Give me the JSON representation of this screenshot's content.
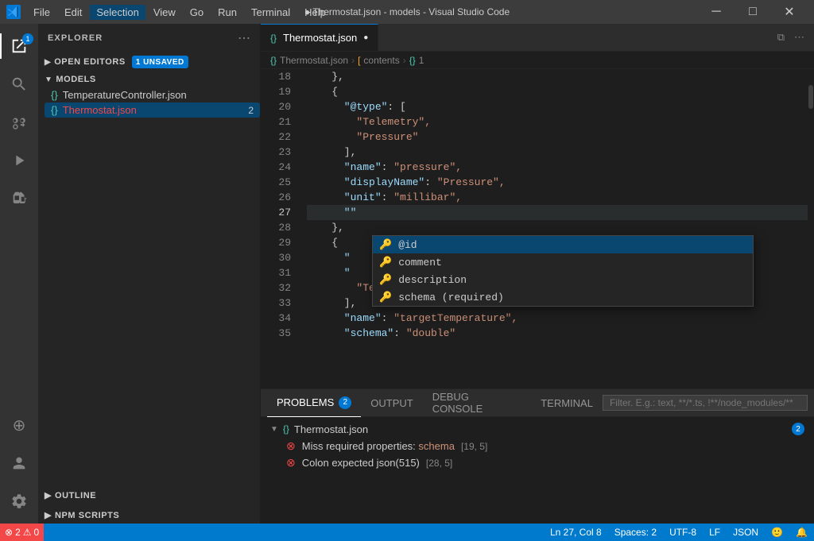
{
  "titlebar": {
    "logo": "VS",
    "menu_items": [
      "File",
      "Edit",
      "Selection",
      "View",
      "Go",
      "Run",
      "Terminal",
      "Help"
    ],
    "active_menu": "Selection",
    "title": "● Thermostat.json - models - Visual Studio Code",
    "ctrl_minimize": "─",
    "ctrl_maximize": "□",
    "ctrl_close": "✕"
  },
  "activity_bar": {
    "icons": [
      {
        "name": "explorer-icon",
        "symbol": "⎘",
        "active": true,
        "badge": "1"
      },
      {
        "name": "search-icon",
        "symbol": "🔍",
        "active": false
      },
      {
        "name": "source-control-icon",
        "symbol": "⑂",
        "active": false
      },
      {
        "name": "run-icon",
        "symbol": "▷",
        "active": false
      },
      {
        "name": "extensions-icon",
        "symbol": "⊞",
        "active": false
      },
      {
        "name": "remote-explorer-icon",
        "symbol": "⊕",
        "active": false
      }
    ],
    "bottom_icons": [
      {
        "name": "account-icon",
        "symbol": "👤"
      },
      {
        "name": "settings-icon",
        "symbol": "⚙"
      }
    ]
  },
  "sidebar": {
    "header": "EXPLORER",
    "sections": {
      "open_editors": {
        "label": "OPEN EDITORS",
        "badge": "1 UNSAVED",
        "collapsed": false
      },
      "models": {
        "label": "MODELS",
        "expanded": true,
        "files": [
          {
            "name": "TemperatureController.json",
            "icon": "{}",
            "active": false,
            "errors": 0
          },
          {
            "name": "Thermostat.json",
            "icon": "{}",
            "active": true,
            "errors": 2
          }
        ]
      },
      "outline": {
        "label": "OUTLINE"
      },
      "npm_scripts": {
        "label": "NPM SCRIPTS"
      }
    }
  },
  "editor": {
    "tab": {
      "icon": "{}",
      "filename": "Thermostat.json",
      "modified": true
    },
    "breadcrumb": [
      {
        "icon": "{}",
        "text": "Thermostat.json"
      },
      {
        "icon": "[",
        "text": "contents"
      },
      {
        "icon": "{}",
        "text": "1"
      }
    ],
    "lines": [
      {
        "num": 18,
        "content": "    },",
        "tokens": [
          {
            "t": "s-punct",
            "v": "    },"
          }
        ]
      },
      {
        "num": 19,
        "content": "    {",
        "tokens": [
          {
            "t": "s-punct",
            "v": "    {"
          }
        ]
      },
      {
        "num": 20,
        "content": "      \"@type\": [",
        "tokens": [
          {
            "t": "s-key",
            "v": "      \"@type\""
          },
          {
            "t": "s-punct",
            "v": ": ["
          }
        ]
      },
      {
        "num": 21,
        "content": "        \"Telemetry\",",
        "tokens": [
          {
            "t": "s-string",
            "v": "        \"Telemetry\","
          }
        ]
      },
      {
        "num": 22,
        "content": "        \"Pressure\"",
        "tokens": [
          {
            "t": "s-string",
            "v": "        \"Pressure\""
          }
        ]
      },
      {
        "num": 23,
        "content": "      ],",
        "tokens": [
          {
            "t": "s-punct",
            "v": "      ],"
          }
        ]
      },
      {
        "num": 24,
        "content": "      \"name\": \"pressure\",",
        "tokens": [
          {
            "t": "s-key",
            "v": "      \"name\""
          },
          {
            "t": "s-punct",
            "v": ": "
          },
          {
            "t": "s-string",
            "v": "\"pressure\","
          }
        ]
      },
      {
        "num": 25,
        "content": "      \"displayName\": \"Pressure\",",
        "tokens": [
          {
            "t": "s-key",
            "v": "      \"displayName\""
          },
          {
            "t": "s-punct",
            "v": ": "
          },
          {
            "t": "s-string",
            "v": "\"Pressure\","
          }
        ]
      },
      {
        "num": 26,
        "content": "      \"unit\": \"millibar\",",
        "tokens": [
          {
            "t": "s-key",
            "v": "      \"unit\""
          },
          {
            "t": "s-punct",
            "v": ": "
          },
          {
            "t": "s-string",
            "v": "\"millibar\","
          }
        ]
      },
      {
        "num": 27,
        "content": "      \"\"",
        "tokens": [
          {
            "t": "s-key",
            "v": "      \"\""
          }
        ],
        "current": true
      },
      {
        "num": 28,
        "content": "    },",
        "tokens": [
          {
            "t": "s-punct",
            "v": "    },"
          }
        ]
      },
      {
        "num": 29,
        "content": "    {",
        "tokens": [
          {
            "t": "s-punct",
            "v": "    {"
          }
        ]
      },
      {
        "num": 30,
        "content": "      \"",
        "tokens": [
          {
            "t": "s-key",
            "v": "      \""
          }
        ]
      },
      {
        "num": 31,
        "content": "      \"",
        "tokens": [
          {
            "t": "s-key",
            "v": "      \""
          }
        ]
      },
      {
        "num": 32,
        "content": "        \"Temperature\"",
        "tokens": [
          {
            "t": "s-string",
            "v": "        \"Temperature\""
          }
        ]
      },
      {
        "num": 33,
        "content": "      ],",
        "tokens": [
          {
            "t": "s-punct",
            "v": "      ],"
          }
        ]
      },
      {
        "num": 34,
        "content": "      \"name\": \"targetTemperature\",",
        "tokens": [
          {
            "t": "s-key",
            "v": "      \"name\""
          },
          {
            "t": "s-punct",
            "v": ": "
          },
          {
            "t": "s-string",
            "v": "\"targetTemperature\","
          }
        ]
      },
      {
        "num": 35,
        "content": "      \"schema\": \"double\"",
        "tokens": [
          {
            "t": "s-key",
            "v": "      \"schema\""
          },
          {
            "t": "s-punct",
            "v": ": "
          },
          {
            "t": "s-string",
            "v": "\"double\""
          }
        ]
      }
    ],
    "autocomplete": {
      "items": [
        {
          "icon": "🔑",
          "text": "@id",
          "selected": true
        },
        {
          "icon": "🔑",
          "text": "comment",
          "selected": false
        },
        {
          "icon": "🔑",
          "text": "description",
          "selected": false
        },
        {
          "icon": "🔑",
          "text": "schema (required)",
          "selected": false
        }
      ]
    }
  },
  "bottom_panel": {
    "tabs": [
      {
        "label": "PROBLEMS",
        "badge": "2",
        "active": true
      },
      {
        "label": "OUTPUT",
        "badge": null,
        "active": false
      },
      {
        "label": "DEBUG CONSOLE",
        "badge": null,
        "active": false
      },
      {
        "label": "TERMINAL",
        "badge": null,
        "active": false
      }
    ],
    "filter_placeholder": "Filter. E.g.: text, **/*.ts, !**/node_modules/**",
    "error_groups": [
      {
        "file_icon": "{}",
        "filename": "Thermostat.json",
        "badge": "2",
        "errors": [
          {
            "msg": "Miss required properties: schema",
            "loc": "[19, 5]"
          },
          {
            "msg": "Colon expected  json(515)",
            "loc": "[28, 5]"
          }
        ]
      }
    ]
  },
  "status_bar": {
    "error_count": "2",
    "warning_count": "0",
    "position": "Ln 27, Col 8",
    "spaces": "Spaces: 2",
    "encoding": "UTF-8",
    "line_ending": "LF",
    "language": "JSON",
    "notifications_icon": "🔔",
    "remote_icon": "⚡"
  }
}
